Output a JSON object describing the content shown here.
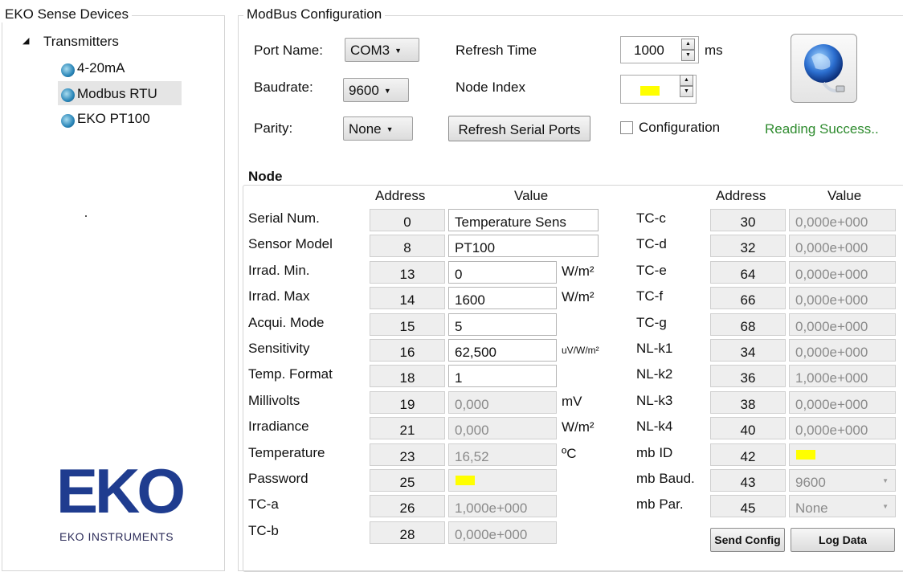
{
  "left_panel": {
    "title": "EKO Sense Devices",
    "tree": {
      "root": "Transmitters",
      "items": [
        "4-20mA",
        "Modbus RTU",
        "EKO PT100"
      ],
      "selected": "Modbus RTU"
    },
    "logo": {
      "text": "EKO",
      "caption": "EKO INSTRUMENTS"
    }
  },
  "modbus": {
    "title": "ModBus Configuration",
    "port_label": "Port Name:",
    "port_value": "COM3",
    "baud_label": "Baudrate:",
    "baud_value": "9600",
    "parity_label": "Parity:",
    "parity_value": "None",
    "refresh_time_label": "Refresh Time",
    "refresh_time_value": "1000",
    "refresh_time_unit": "ms",
    "node_index_label": "Node Index",
    "refresh_ports_label": "Refresh Serial Ports",
    "configuration_label": "Configuration",
    "configuration_checked": false,
    "status": "Reading Success..",
    "status_color": "#2e8b2e"
  },
  "node": {
    "title": "Node",
    "headers": {
      "address": "Address",
      "value": "Value"
    },
    "left_rows": [
      {
        "label": "Serial Num.",
        "address": "0",
        "value": "Temperature Sens",
        "unit": "",
        "editable": true
      },
      {
        "label": "Sensor Model",
        "address": "8",
        "value": "PT100",
        "unit": "",
        "editable": true
      },
      {
        "label": "Irrad. Min.",
        "address": "13",
        "value": "0",
        "unit": "W/m²",
        "editable": true
      },
      {
        "label": "Irrad. Max",
        "address": "14",
        "value": "1600",
        "unit": "W/m²",
        "editable": true
      },
      {
        "label": "Acqui. Mode",
        "address": "15",
        "value": "5",
        "unit": "",
        "editable": true
      },
      {
        "label": "Sensitivity",
        "address": "16",
        "value": "62,500",
        "unit": "uV/W/m²",
        "editable": true
      },
      {
        "label": "Temp. Format",
        "address": "18",
        "value": "1",
        "unit": "",
        "editable": true
      },
      {
        "label": "Millivolts",
        "address": "19",
        "value": "0,000",
        "unit": "mV",
        "editable": false
      },
      {
        "label": "Irradiance",
        "address": "21",
        "value": "0,000",
        "unit": "W/m²",
        "editable": false
      },
      {
        "label": "Temperature",
        "address": "23",
        "value": "16,52",
        "unit": "ºC",
        "editable": false
      },
      {
        "label": "Password",
        "address": "25",
        "value": "",
        "unit": "",
        "editable": false,
        "highlight": true
      },
      {
        "label": "TC-a",
        "address": "26",
        "value": "1,000e+000",
        "unit": "",
        "editable": false
      },
      {
        "label": "TC-b",
        "address": "28",
        "value": "0,000e+000",
        "unit": "",
        "editable": false
      }
    ],
    "right_rows": [
      {
        "label": "TC-c",
        "address": "30",
        "value": "0,000e+000"
      },
      {
        "label": "TC-d",
        "address": "32",
        "value": "0,000e+000"
      },
      {
        "label": "TC-e",
        "address": "64",
        "value": "0,000e+000"
      },
      {
        "label": "TC-f",
        "address": "66",
        "value": "0,000e+000"
      },
      {
        "label": "TC-g",
        "address": "68",
        "value": "0,000e+000"
      },
      {
        "label": "NL-k1",
        "address": "34",
        "value": "0,000e+000"
      },
      {
        "label": "NL-k2",
        "address": "36",
        "value": "1,000e+000"
      },
      {
        "label": "NL-k3",
        "address": "38",
        "value": "0,000e+000"
      },
      {
        "label": "NL-k4",
        "address": "40",
        "value": "0,000e+000"
      },
      {
        "label": "mb ID",
        "address": "42",
        "value": "",
        "highlight": true
      },
      {
        "label": "mb Baud.",
        "address": "43",
        "value": "9600",
        "dropdown": true
      },
      {
        "label": "mb Par.",
        "address": "45",
        "value": "None",
        "dropdown": true
      }
    ],
    "send_config_label": "Send Config",
    "log_data_label": "Log Data"
  }
}
